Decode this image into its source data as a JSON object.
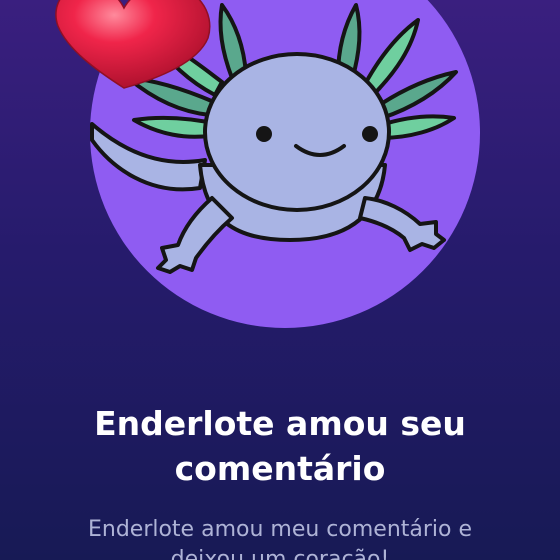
{
  "notification": {
    "title_line1": "Enderlote amou seu",
    "title_line2": "comentário",
    "subtitle_line1": "Enderlote amou meu comentário e",
    "subtitle_line2": "deixou um coração!"
  },
  "icons": {
    "avatar": "axolotl-avatar",
    "reaction": "heart-icon"
  },
  "colors": {
    "background_top": "#3a1f7f",
    "background_bottom": "#171a55",
    "avatar_circle": "#8f5cf2",
    "heart": "#f0254a",
    "title_text": "#ffffff",
    "subtitle_text": "#aeb3d6"
  }
}
